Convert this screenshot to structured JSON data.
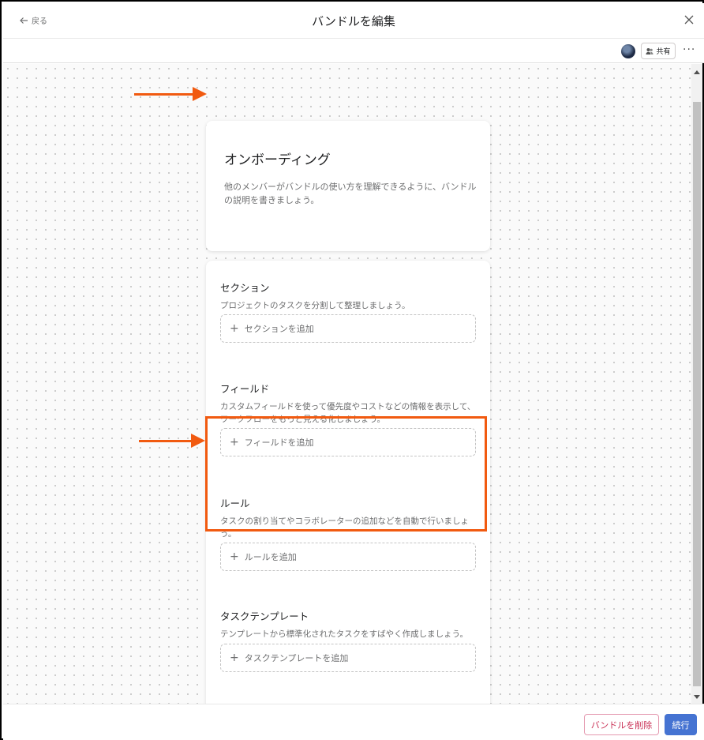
{
  "header": {
    "back_label": "戻る",
    "title": "バンドルを編集"
  },
  "subbar": {
    "share_label": "共有",
    "more_label": "···"
  },
  "bundle": {
    "name": "オンボーディング",
    "description_placeholder": "他のメンバーがバンドルの使い方を理解できるように、バンドルの説明を書きましょう。"
  },
  "sections": [
    {
      "title": "セクション",
      "description": "プロジェクトのタスクを分割して整理しましょう。",
      "add_label": "セクションを追加"
    },
    {
      "title": "フィールド",
      "description": "カスタムフィールドを使って優先度やコストなどの情報を表示して、ワークフローをもっと見える化しましょう。",
      "add_label": "フィールドを追加"
    },
    {
      "title": "ルール",
      "description": "タスクの割り当てやコラボレーターの追加などを自動で行いましょう。",
      "add_label": "ルールを追加"
    },
    {
      "title": "タスクテンプレート",
      "description": "テンプレートから標準化されたタスクをすばやく作成しましょう。",
      "add_label": "タスクテンプレートを追加"
    }
  ],
  "footer": {
    "delete_label": "バンドルを削除",
    "continue_label": "続行"
  },
  "colors": {
    "annotation": "#f15a10",
    "primary": "#4573d2",
    "danger": "#c92f54"
  }
}
